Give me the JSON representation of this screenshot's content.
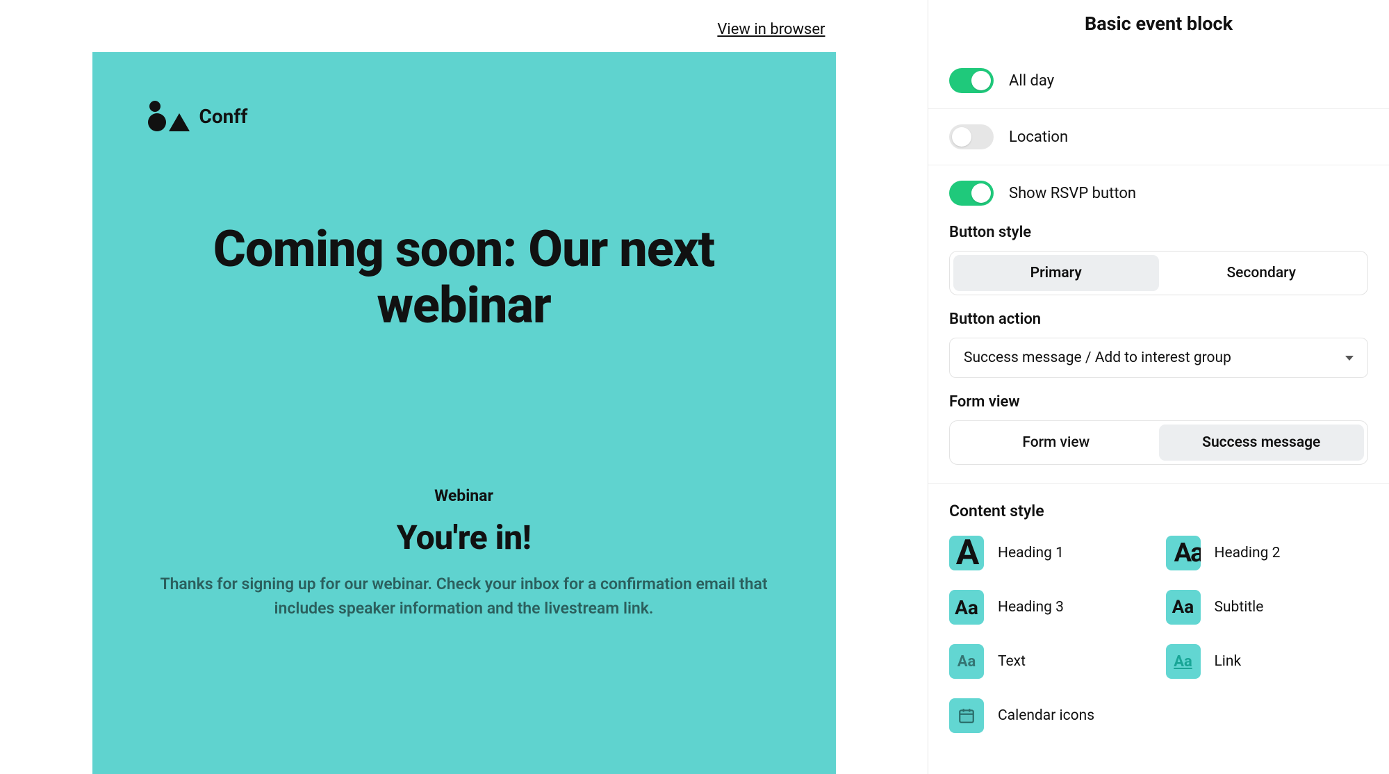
{
  "viewBrowser": "View in browser",
  "brand": "Conff",
  "emailTitle": "Coming soon: Our next webinar",
  "sectionLabel": "Webinar",
  "sectionHeadline": "You're in!",
  "sectionBody": "Thanks for signing up for our webinar. Check your inbox for a confirmation email that includes speaker information and the livestream link.",
  "sidebar": {
    "title": "Basic event block",
    "toggles": {
      "allDay": "All day",
      "location": "Location",
      "showRsvp": "Show RSVP button"
    },
    "buttonStyleLabel": "Button style",
    "buttonPrimary": "Primary",
    "buttonSecondary": "Secondary",
    "buttonActionLabel": "Button action",
    "buttonActionValue": "Success message / Add to interest group",
    "formViewLabel": "Form view",
    "formViewOption": "Form view",
    "successMessageOption": "Success message",
    "contentStyleLabel": "Content style",
    "styles": {
      "h1": "Heading 1",
      "h2": "Heading 2",
      "h3": "Heading 3",
      "sub": "Subtitle",
      "txt": "Text",
      "lnk": "Link",
      "cal": "Calendar icons"
    }
  }
}
